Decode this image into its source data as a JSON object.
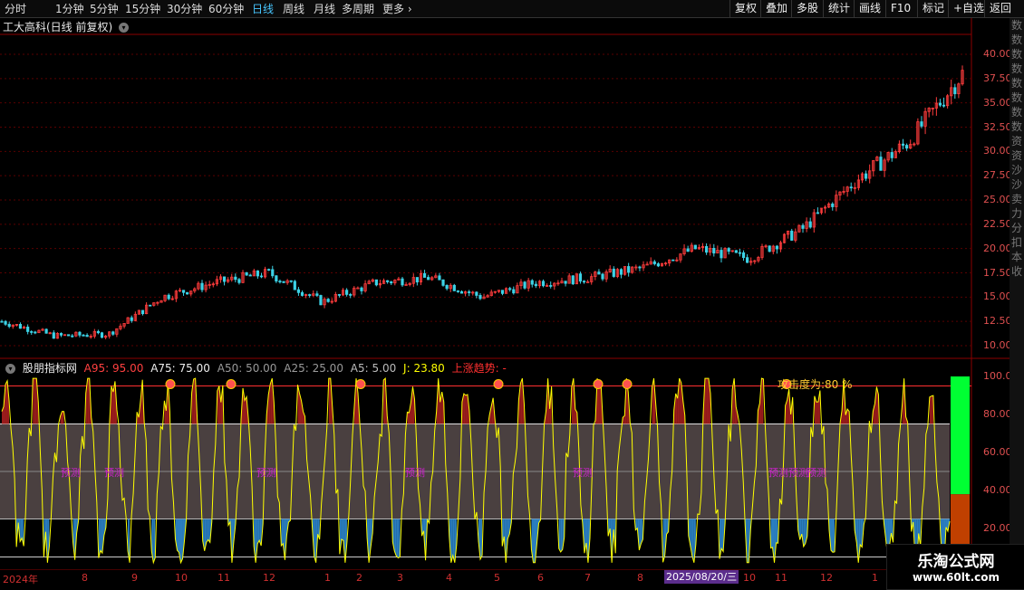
{
  "toolbar": {
    "periods": [
      "分时",
      "1分钟",
      "5分钟",
      "15分钟",
      "30分钟",
      "60分钟",
      "日线",
      "周线",
      "月线",
      "多周期",
      "更多"
    ],
    "active_period": "日线",
    "right_buttons": [
      "复权",
      "叠加",
      "多股",
      "统计",
      "画线",
      "F10",
      "标记",
      "+自选",
      "返回"
    ]
  },
  "stock": {
    "title": "工大高科(日线 前复权)"
  },
  "price_axis": {
    "ticks": [
      "40.00",
      "37.50",
      "35.00",
      "32.50",
      "30.00",
      "27.50",
      "25.00",
      "22.50",
      "20.00",
      "17.50",
      "15.00",
      "12.50",
      "10.00"
    ]
  },
  "indicator": {
    "name": "股朋指标网",
    "a95": "A95: 95.00",
    "a75": "A75: 75.00",
    "a50": "A50: 50.00",
    "a25": "A25: 25.00",
    "a5": "A5: 5.00",
    "j": "J: 23.80",
    "trend": "上涨趋势: -",
    "attack": "攻击度为:80 %",
    "predict_label": "预测",
    "ticks": [
      "100.0",
      "80.00",
      "60.00",
      "40.00",
      "20.00"
    ]
  },
  "date_axis": {
    "labels": [
      "2024年",
      "8",
      "9",
      "10",
      "11",
      "12",
      "1",
      "2",
      "3",
      "4",
      "5",
      "6",
      "7",
      "8",
      "10",
      "11",
      "12",
      "1"
    ],
    "highlight": "2025/08/20/三"
  },
  "right_strip": {
    "chars": [
      "数",
      "数",
      "数",
      "数",
      "数",
      "数",
      "数",
      "数",
      "资",
      "资",
      "沙",
      "沙",
      "卖",
      "力",
      "分",
      "扣",
      "本",
      "收"
    ]
  },
  "watermark": {
    "line1": "乐淘公式网",
    "line2": "www.60lt.com"
  },
  "chart_data": {
    "type": "line",
    "price_series": {
      "name": "",
      "x": [
        "2024-07",
        "2024-08",
        "2024-09",
        "2024-10",
        "2024-11",
        "2024-12",
        "2025-01",
        "2025-02",
        "2025-03",
        "2025-04",
        "2025-05",
        "2025-06",
        "2025-07",
        "2025-08",
        "2025-09",
        "2025-10",
        "2025-11",
        "2025-12",
        "2026-01"
      ],
      "values": [
        12.5,
        11.0,
        11.2,
        15.0,
        16.5,
        17.5,
        14.5,
        16.5,
        17.0,
        15.0,
        16.5,
        17.0,
        18.0,
        20.0,
        19.0,
        22.0,
        27.0,
        31.0,
        38.0
      ]
    },
    "indicator_levels": [
      95,
      75,
      50,
      25,
      5
    ],
    "ylim_price": [
      9.5,
      42
    ],
    "ylim_indicator": [
      0,
      100
    ]
  }
}
